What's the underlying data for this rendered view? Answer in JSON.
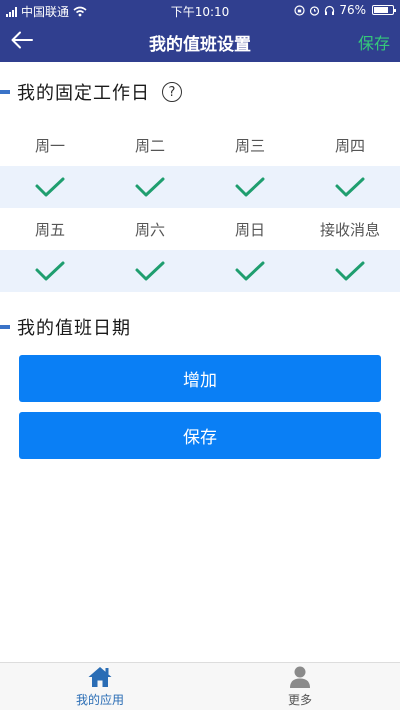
{
  "status": {
    "carrier": "中国联通",
    "time": "下午10:10",
    "battery": "76%"
  },
  "nav": {
    "title": "我的值班设置",
    "save_label": "保存"
  },
  "fixed_days_section": {
    "title": "我的固定工作日",
    "help": "?"
  },
  "days_row1": [
    {
      "label": "周一",
      "checked": true
    },
    {
      "label": "周二",
      "checked": true
    },
    {
      "label": "周三",
      "checked": true
    },
    {
      "label": "周四",
      "checked": true
    }
  ],
  "days_row2": [
    {
      "label": "周五",
      "checked": true
    },
    {
      "label": "周六",
      "checked": true
    },
    {
      "label": "周日",
      "checked": true
    },
    {
      "label": "接收消息",
      "checked": true
    }
  ],
  "duty_dates_section": {
    "title": "我的值班日期"
  },
  "buttons": {
    "add_label": "增加",
    "save_label": "保存"
  },
  "tabbar": {
    "tabs": [
      {
        "label": "我的应用",
        "icon": "home-icon",
        "active": true
      },
      {
        "label": "更多",
        "icon": "user-icon",
        "active": false
      }
    ]
  },
  "colors": {
    "header_bg": "#303f8f",
    "accent_green": "#35c87a",
    "check_green": "#1f9e6f",
    "primary_button": "#0a7ff5",
    "section_marker": "#3a73c8",
    "tab_active": "#2a6db5",
    "tab_inactive": "#888888"
  }
}
